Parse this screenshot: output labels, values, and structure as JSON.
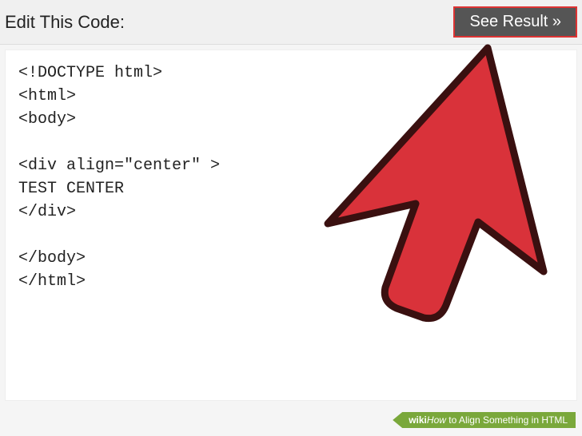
{
  "header": {
    "title": "Edit This Code:",
    "button_label": "See Result »"
  },
  "code": {
    "lines": [
      "<!DOCTYPE html>",
      "<html>",
      "<body>",
      "",
      "<div align=\"center\" >",
      "TEST CENTER",
      "</div>",
      "",
      "</body>",
      "</html>"
    ]
  },
  "footer": {
    "wiki": "wiki",
    "how": "How",
    "title": " to Align Something in HTML"
  },
  "colors": {
    "cursor_fill": "#d9323a",
    "cursor_stroke": "#3a1010",
    "button_border": "#d33",
    "ribbon": "#7aa83b"
  }
}
